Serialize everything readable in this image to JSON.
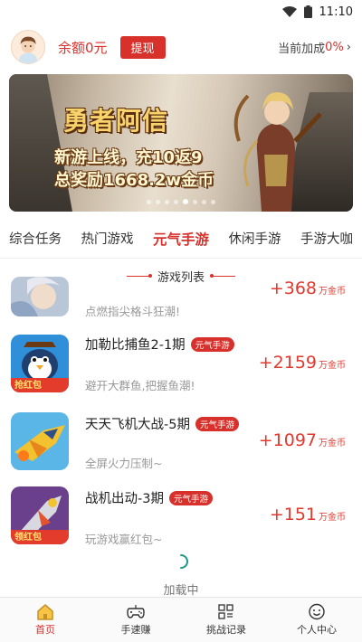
{
  "status_bar": {
    "time": "11:10"
  },
  "header": {
    "balance": "余额0元",
    "withdraw_label": "提现",
    "bonus_label": "当前加成",
    "bonus_value": "0%",
    "bonus_chevron": "›"
  },
  "banner": {
    "logo_text": "勇者阿信",
    "line1": "新游上线，充10返9",
    "line2": "总奖励1668.2w金币",
    "dot_count": 8,
    "active_dot": 4
  },
  "tabs": [
    {
      "label": "综合任务",
      "active": false
    },
    {
      "label": "热门游戏",
      "active": false
    },
    {
      "label": "元气手游",
      "active": true
    },
    {
      "label": "休闲手游",
      "active": false
    },
    {
      "label": "手游大咖",
      "active": false
    }
  ],
  "section_title": "游戏列表",
  "games": [
    {
      "name": "",
      "tag": "",
      "desc": "点燃指尖格斗狂潮!",
      "reward": "+368",
      "unit": "万金币",
      "icon": "fantasy-girl-icon"
    },
    {
      "name": "加勒比捕鱼2-1期",
      "tag": "元气手游",
      "desc": "避开大群鱼,把握鱼潮!",
      "reward": "+2159",
      "unit": "万金币",
      "icon": "penguin-fish-icon",
      "badge": "抢红包"
    },
    {
      "name": "天天飞机大战-5期",
      "tag": "元气手游",
      "desc": "全屏火力压制~",
      "reward": "+1097",
      "unit": "万金币",
      "icon": "jet-plane-icon"
    },
    {
      "name": "战机出动-3期",
      "tag": "元气手游",
      "desc": "玩游戏赢红包~",
      "reward": "+151",
      "unit": "万金币",
      "icon": "fighter-jet-icon",
      "badge": "领红包"
    }
  ],
  "loading_text": "加载中",
  "bottom_nav": [
    {
      "label": "首页",
      "icon": "home-icon",
      "active": true
    },
    {
      "label": "手速赚",
      "icon": "gamepad-icon",
      "active": false
    },
    {
      "label": "挑战记录",
      "icon": "grid-record-icon",
      "active": false
    },
    {
      "label": "个人中心",
      "icon": "smiley-user-icon",
      "active": false
    }
  ],
  "colors": {
    "accent": "#d8302b",
    "reward": "#e0392f"
  }
}
